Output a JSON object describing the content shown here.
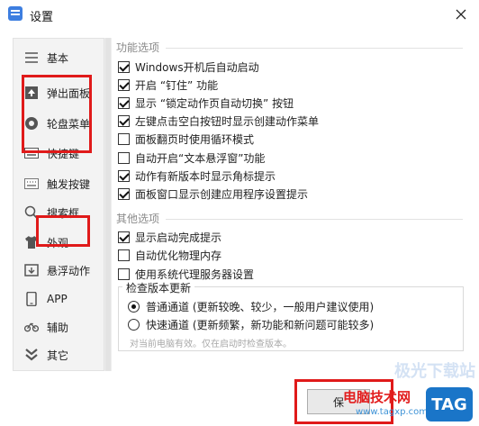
{
  "window": {
    "title": "设置",
    "close_glyph": "✕"
  },
  "sidebar": {
    "items": [
      {
        "label": "基本",
        "icon": "list-icon"
      },
      {
        "label": "弹出面板",
        "icon": "upload-icon"
      },
      {
        "label": "轮盘菜单",
        "icon": "wheel-icon"
      },
      {
        "label": "快捷键",
        "icon": "keyboard-icon"
      },
      {
        "label": "触发按键",
        "icon": "keyboard-icon"
      },
      {
        "label": "搜索框",
        "icon": "search-icon"
      },
      {
        "label": "外观",
        "icon": "tshirt-icon"
      },
      {
        "label": "悬浮动作",
        "icon": "hover-icon"
      },
      {
        "label": "APP",
        "icon": "phone-icon"
      },
      {
        "label": "辅助",
        "icon": "bike-icon"
      },
      {
        "label": "其它",
        "icon": "chevrons-icon"
      }
    ]
  },
  "main": {
    "feature_section": {
      "title": "功能选项",
      "options": [
        {
          "label": "Windows开机后自动启动",
          "checked": true
        },
        {
          "label": "开启 “钉住” 功能",
          "checked": true
        },
        {
          "label": "显示 “锁定动作页自动切换” 按钮",
          "checked": true
        },
        {
          "label": "左键点击空白按钮时显示创建动作菜单",
          "checked": true
        },
        {
          "label": "面板翻页时使用循环模式",
          "checked": false
        },
        {
          "label": "自动开启“文本悬浮窗”功能",
          "checked": false
        },
        {
          "label": "动作有新版本时显示角标提示",
          "checked": true
        },
        {
          "label": "面板窗口显示创建应用程序设置提示",
          "checked": true
        }
      ]
    },
    "other_section": {
      "title": "其他选项",
      "options": [
        {
          "label": "显示启动完成提示",
          "checked": true
        },
        {
          "label": "自动优化物理内存",
          "checked": false
        },
        {
          "label": "使用系统代理服务器设置",
          "checked": false
        }
      ]
    },
    "update_group": {
      "title": "检查版本更新",
      "options": [
        {
          "label": "普通通道 (更新较晚、较少，一般用户建议使用)",
          "selected": true
        },
        {
          "label": "快速通道 (更新频繁，新功能和新问题可能较多)",
          "selected": false
        }
      ],
      "note": "对当前电脑有效。仅在启动时检查版本。"
    }
  },
  "footer": {
    "save_label": "保",
    "watermark_text": "电脑技术网",
    "watermark_url": "www.tagxp.com",
    "watermark_logo": "TAG",
    "watermark_faint": "极光下载站"
  },
  "colors": {
    "highlight": "#e01a1a",
    "accent": "#1a75c8"
  }
}
